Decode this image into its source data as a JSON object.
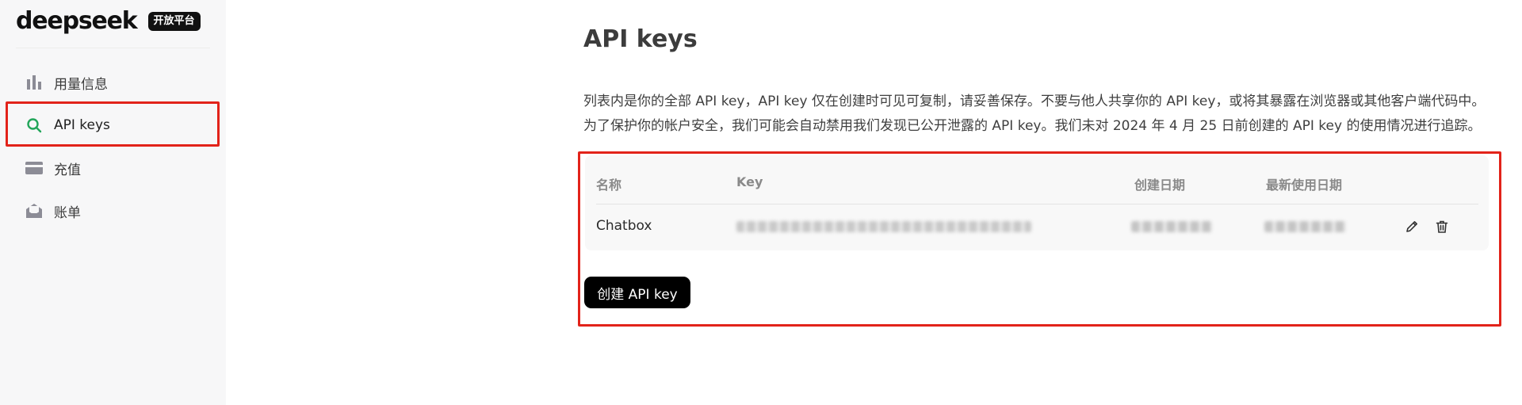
{
  "logo": {
    "text": "deepseek",
    "badge": "开放平台"
  },
  "sidebar": {
    "items": [
      {
        "label": "用量信息",
        "icon": "bar-chart-icon"
      },
      {
        "label": "API keys",
        "icon": "search-key-icon",
        "active": true
      },
      {
        "label": "充值",
        "icon": "card-icon"
      },
      {
        "label": "账单",
        "icon": "bill-icon"
      }
    ]
  },
  "main": {
    "title": "API keys",
    "description": [
      "列表内是你的全部 API key，API key 仅在创建时可见可复制，请妥善保存。不要与他人共享你的 API key，或将其暴露在浏览器或其他客户端代码中。",
      "为了保护你的帐户安全，我们可能会自动禁用我们发现已公开泄露的 API key。我们未对 2024 年 4 月 25 日前创建的 API key 的使用情况进行追踪。"
    ],
    "table": {
      "columns": [
        "名称",
        "Key",
        "创建日期",
        "最新使用日期"
      ],
      "rows": [
        {
          "name": "Chatbox"
        }
      ]
    },
    "create_button": "创建 API key"
  },
  "colors": {
    "accent": "#22a55a",
    "highlight": "#e2231a",
    "button_bg": "#000000"
  }
}
